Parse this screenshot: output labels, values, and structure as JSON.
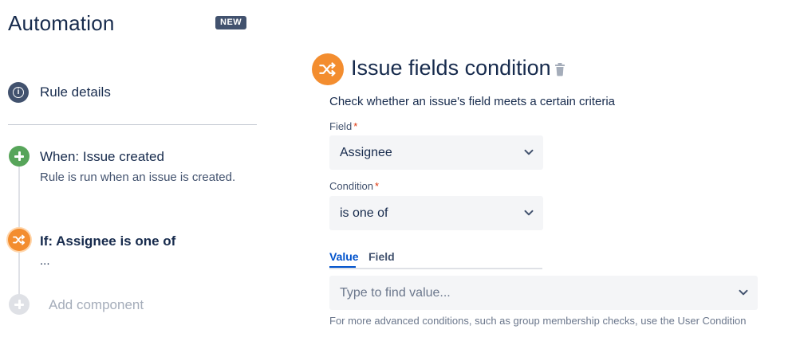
{
  "header": {
    "title": "Automation",
    "badge": "NEW"
  },
  "sidebar": {
    "rule_details": "Rule details",
    "steps": [
      {
        "type": "trigger",
        "title": "When: Issue created",
        "subtitle": "Rule is run when an issue is created."
      },
      {
        "type": "condition",
        "title": "If: Assignee is one of",
        "subtitle": "..."
      }
    ],
    "add_component": "Add component"
  },
  "panel": {
    "title": "Issue fields condition",
    "description": "Check whether an issue's field meets a certain criteria",
    "field": {
      "label": "Field",
      "required_mark": "*",
      "value": "Assignee"
    },
    "condition": {
      "label": "Condition",
      "required_mark": "*",
      "value": "is one of"
    },
    "tabs": [
      {
        "label": "Value",
        "active": true
      },
      {
        "label": "Field",
        "active": false
      }
    ],
    "value_input": {
      "placeholder": "Type to find value..."
    },
    "helper_text": "For more advanced conditions, such as group membership checks, use the User Condition"
  },
  "colors": {
    "condition_accent": "#f38d2f",
    "trigger_accent": "#57a55a",
    "info_icon": "#42526e",
    "link_blue": "#0052cc"
  },
  "icons": {
    "rule_details": "info-icon",
    "trigger": "plus-icon",
    "condition": "shuffle-icon",
    "add": "plus-icon",
    "delete": "trash-icon",
    "dropdown": "chevron-down-icon"
  }
}
